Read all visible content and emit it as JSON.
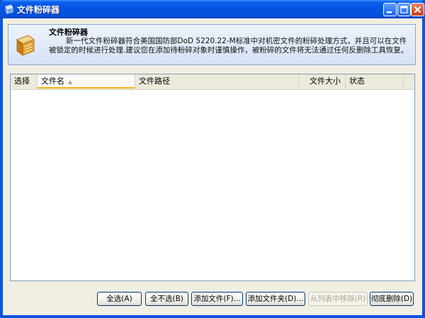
{
  "window": {
    "title": "文件粉碎器"
  },
  "info": {
    "title": "文件粉碎器",
    "description": "新一代文件粉碎器符合美国国防部DoD 5220.22-M标准中对机密文件的粉碎处理方式，并且可以在文件被锁定的时候进行处理.建议您在添加待粉碎对象时谨慎操作，被粉碎的文件将无法通过任何反删除工具恢复。"
  },
  "list": {
    "columns": [
      "选择",
      "文件名",
      "文件路径",
      "文件大小",
      "状态"
    ],
    "sorted_column": "文件名",
    "rows": []
  },
  "buttons": {
    "select_all": "全选(A)",
    "select_none": "全不选(B)",
    "add_file": "添加文件(F)...",
    "add_folder": "添加文件夹(D)...",
    "remove_from_list": "从列表中移除(R)",
    "shred": "彻底删除(D)"
  },
  "icons": {
    "app": "shredder-icon",
    "minimize": "minimize-icon",
    "maximize": "maximize-icon",
    "close": "close-icon"
  },
  "colors": {
    "titlebar": "#0554e2",
    "client": "#f1efe2",
    "sort_highlight": "#f9b119"
  }
}
